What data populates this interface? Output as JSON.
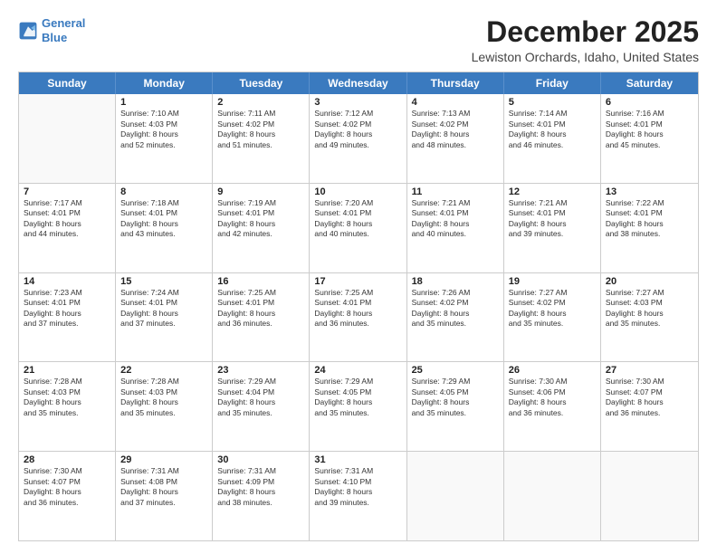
{
  "logo": {
    "line1": "General",
    "line2": "Blue"
  },
  "title": "December 2025",
  "location": "Lewiston Orchards, Idaho, United States",
  "days_of_week": [
    "Sunday",
    "Monday",
    "Tuesday",
    "Wednesday",
    "Thursday",
    "Friday",
    "Saturday"
  ],
  "weeks": [
    [
      {
        "day": "",
        "lines": []
      },
      {
        "day": "1",
        "lines": [
          "Sunrise: 7:10 AM",
          "Sunset: 4:03 PM",
          "Daylight: 8 hours",
          "and 52 minutes."
        ]
      },
      {
        "day": "2",
        "lines": [
          "Sunrise: 7:11 AM",
          "Sunset: 4:02 PM",
          "Daylight: 8 hours",
          "and 51 minutes."
        ]
      },
      {
        "day": "3",
        "lines": [
          "Sunrise: 7:12 AM",
          "Sunset: 4:02 PM",
          "Daylight: 8 hours",
          "and 49 minutes."
        ]
      },
      {
        "day": "4",
        "lines": [
          "Sunrise: 7:13 AM",
          "Sunset: 4:02 PM",
          "Daylight: 8 hours",
          "and 48 minutes."
        ]
      },
      {
        "day": "5",
        "lines": [
          "Sunrise: 7:14 AM",
          "Sunset: 4:01 PM",
          "Daylight: 8 hours",
          "and 46 minutes."
        ]
      },
      {
        "day": "6",
        "lines": [
          "Sunrise: 7:16 AM",
          "Sunset: 4:01 PM",
          "Daylight: 8 hours",
          "and 45 minutes."
        ]
      }
    ],
    [
      {
        "day": "7",
        "lines": [
          "Sunrise: 7:17 AM",
          "Sunset: 4:01 PM",
          "Daylight: 8 hours",
          "and 44 minutes."
        ]
      },
      {
        "day": "8",
        "lines": [
          "Sunrise: 7:18 AM",
          "Sunset: 4:01 PM",
          "Daylight: 8 hours",
          "and 43 minutes."
        ]
      },
      {
        "day": "9",
        "lines": [
          "Sunrise: 7:19 AM",
          "Sunset: 4:01 PM",
          "Daylight: 8 hours",
          "and 42 minutes."
        ]
      },
      {
        "day": "10",
        "lines": [
          "Sunrise: 7:20 AM",
          "Sunset: 4:01 PM",
          "Daylight: 8 hours",
          "and 40 minutes."
        ]
      },
      {
        "day": "11",
        "lines": [
          "Sunrise: 7:21 AM",
          "Sunset: 4:01 PM",
          "Daylight: 8 hours",
          "and 40 minutes."
        ]
      },
      {
        "day": "12",
        "lines": [
          "Sunrise: 7:21 AM",
          "Sunset: 4:01 PM",
          "Daylight: 8 hours",
          "and 39 minutes."
        ]
      },
      {
        "day": "13",
        "lines": [
          "Sunrise: 7:22 AM",
          "Sunset: 4:01 PM",
          "Daylight: 8 hours",
          "and 38 minutes."
        ]
      }
    ],
    [
      {
        "day": "14",
        "lines": [
          "Sunrise: 7:23 AM",
          "Sunset: 4:01 PM",
          "Daylight: 8 hours",
          "and 37 minutes."
        ]
      },
      {
        "day": "15",
        "lines": [
          "Sunrise: 7:24 AM",
          "Sunset: 4:01 PM",
          "Daylight: 8 hours",
          "and 37 minutes."
        ]
      },
      {
        "day": "16",
        "lines": [
          "Sunrise: 7:25 AM",
          "Sunset: 4:01 PM",
          "Daylight: 8 hours",
          "and 36 minutes."
        ]
      },
      {
        "day": "17",
        "lines": [
          "Sunrise: 7:25 AM",
          "Sunset: 4:01 PM",
          "Daylight: 8 hours",
          "and 36 minutes."
        ]
      },
      {
        "day": "18",
        "lines": [
          "Sunrise: 7:26 AM",
          "Sunset: 4:02 PM",
          "Daylight: 8 hours",
          "and 35 minutes."
        ]
      },
      {
        "day": "19",
        "lines": [
          "Sunrise: 7:27 AM",
          "Sunset: 4:02 PM",
          "Daylight: 8 hours",
          "and 35 minutes."
        ]
      },
      {
        "day": "20",
        "lines": [
          "Sunrise: 7:27 AM",
          "Sunset: 4:03 PM",
          "Daylight: 8 hours",
          "and 35 minutes."
        ]
      }
    ],
    [
      {
        "day": "21",
        "lines": [
          "Sunrise: 7:28 AM",
          "Sunset: 4:03 PM",
          "Daylight: 8 hours",
          "and 35 minutes."
        ]
      },
      {
        "day": "22",
        "lines": [
          "Sunrise: 7:28 AM",
          "Sunset: 4:03 PM",
          "Daylight: 8 hours",
          "and 35 minutes."
        ]
      },
      {
        "day": "23",
        "lines": [
          "Sunrise: 7:29 AM",
          "Sunset: 4:04 PM",
          "Daylight: 8 hours",
          "and 35 minutes."
        ]
      },
      {
        "day": "24",
        "lines": [
          "Sunrise: 7:29 AM",
          "Sunset: 4:05 PM",
          "Daylight: 8 hours",
          "and 35 minutes."
        ]
      },
      {
        "day": "25",
        "lines": [
          "Sunrise: 7:29 AM",
          "Sunset: 4:05 PM",
          "Daylight: 8 hours",
          "and 35 minutes."
        ]
      },
      {
        "day": "26",
        "lines": [
          "Sunrise: 7:30 AM",
          "Sunset: 4:06 PM",
          "Daylight: 8 hours",
          "and 36 minutes."
        ]
      },
      {
        "day": "27",
        "lines": [
          "Sunrise: 7:30 AM",
          "Sunset: 4:07 PM",
          "Daylight: 8 hours",
          "and 36 minutes."
        ]
      }
    ],
    [
      {
        "day": "28",
        "lines": [
          "Sunrise: 7:30 AM",
          "Sunset: 4:07 PM",
          "Daylight: 8 hours",
          "and 36 minutes."
        ]
      },
      {
        "day": "29",
        "lines": [
          "Sunrise: 7:31 AM",
          "Sunset: 4:08 PM",
          "Daylight: 8 hours",
          "and 37 minutes."
        ]
      },
      {
        "day": "30",
        "lines": [
          "Sunrise: 7:31 AM",
          "Sunset: 4:09 PM",
          "Daylight: 8 hours",
          "and 38 minutes."
        ]
      },
      {
        "day": "31",
        "lines": [
          "Sunrise: 7:31 AM",
          "Sunset: 4:10 PM",
          "Daylight: 8 hours",
          "and 39 minutes."
        ]
      },
      {
        "day": "",
        "lines": []
      },
      {
        "day": "",
        "lines": []
      },
      {
        "day": "",
        "lines": []
      }
    ]
  ]
}
